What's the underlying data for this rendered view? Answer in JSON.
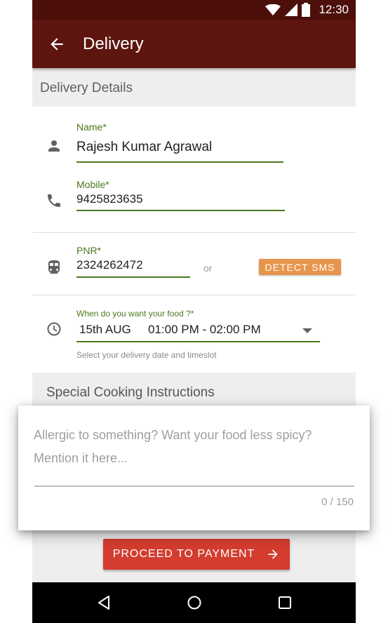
{
  "status_bar": {
    "time": "12:30",
    "icons": [
      "wifi-icon",
      "signal-icon",
      "battery-icon"
    ]
  },
  "app_bar": {
    "title": "Delivery",
    "back_icon": "arrow-back-icon"
  },
  "delivery_details": {
    "heading": "Delivery Details",
    "name": {
      "label": "Name*",
      "value": "Rajesh Kumar Agrawal",
      "icon": "person-icon"
    },
    "mobile": {
      "label": "Mobile*",
      "value": "9425823635",
      "icon": "phone-icon"
    },
    "pnr": {
      "label": "PNR*",
      "value": "2324262472",
      "icon": "train-icon"
    },
    "or_text": "or",
    "detect_sms_label": "DETECT SMS",
    "timeslot": {
      "label": "When do you want your food ?*",
      "date": "15th AUG",
      "slot": "01:00 PM - 02:00 PM",
      "helper": "Select your delivery date and timeslot",
      "icon": "clock-icon"
    }
  },
  "special_instructions": {
    "heading": "Special Cooking Instructions",
    "placeholder": "Allergic to something? Want your food less spicy? Mention it here...",
    "counter": "0 / 150"
  },
  "proceed_label": "PROCEED TO PAYMENT",
  "nav_bar": {
    "icons": [
      "back-triangle-icon",
      "home-circle-icon",
      "recents-square-icon"
    ]
  },
  "colors": {
    "app_bar": "#5e150f",
    "status_bar": "#4c0f0a",
    "accent_green": "#4a7a1e",
    "detect_button": "#e8954c",
    "proceed_button": "#d33c2e"
  }
}
